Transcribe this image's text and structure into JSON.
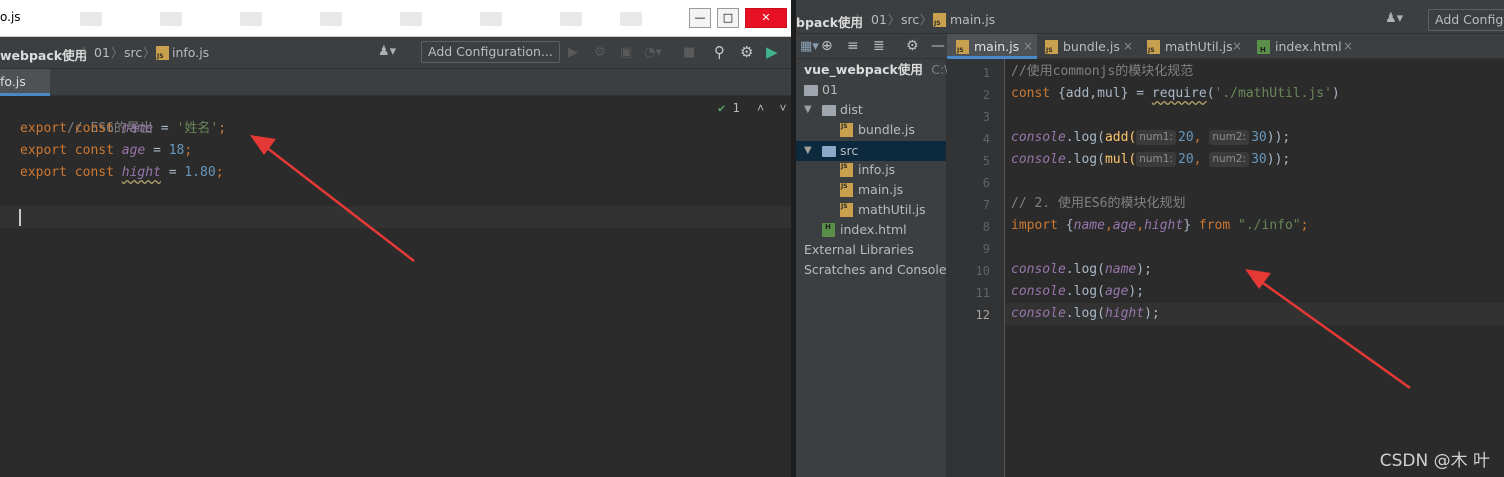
{
  "left": {
    "window_title": "o.js",
    "breadcrumb": [
      "webpack使用",
      "01",
      "src",
      "info.js"
    ],
    "add_configuration": "Add Configuration...",
    "tab": "fo.js",
    "inspection_count": "1",
    "code": {
      "line1_comment": "// ES6的导出",
      "export_kw": "export",
      "const_kw": "const",
      "eq": " = ",
      "semi": ";",
      "var_name": "name",
      "val_name": "'姓名'",
      "var_age": "age",
      "val_age": "18",
      "var_hight": "hight",
      "val_hight": "1.80"
    }
  },
  "right": {
    "breadcrumb": [
      "bpack使用",
      "01",
      "src",
      "main.js"
    ],
    "add_configuration": "Add Config",
    "tabs": [
      {
        "label": "main.js",
        "type": "js",
        "active": true
      },
      {
        "label": "bundle.js",
        "type": "js",
        "active": false
      },
      {
        "label": "mathUtil.js",
        "type": "js",
        "active": false
      },
      {
        "label": "index.html",
        "type": "html",
        "active": false
      }
    ],
    "project_tree": {
      "root": "vue_webpack使用",
      "root_path": "C:\\Us",
      "folder_01": "01",
      "folder_dist": "dist",
      "file_bundle": "bundle.js",
      "folder_src": "src",
      "file_info": "info.js",
      "file_main": "main.js",
      "file_mathutil": "mathUtil.js",
      "file_index": "index.html",
      "external_libraries": "External Libraries",
      "scratches": "Scratches and Consoles"
    },
    "line_numbers": [
      "1",
      "2",
      "3",
      "4",
      "5",
      "6",
      "7",
      "8",
      "9",
      "10",
      "11",
      "12"
    ],
    "code": {
      "l1": "//使用commonjs的模块化规范",
      "const_kw": "const",
      "l2_braces": " {add,mul} = ",
      "require_fn": "require",
      "l2_path": "'./mathUtil.js'",
      "console": "console",
      "log": ".log(",
      "add_fn": "add(",
      "mul_fn": "mul(",
      "hint_num1": "num1:",
      "hint_num2": "num2:",
      "num_20": "20",
      "num_30": "30",
      "comma": ", ",
      "close_parens": "));",
      "l7": "// 2. 使用ES6的模块化规划",
      "import_kw": "import",
      "from_kw": "from",
      "l8_path": "\"./info\"",
      "var_name": "name",
      "var_age": "age",
      "var_hight": "hight",
      "close_log": ");"
    }
  },
  "watermark": "CSDN @木 叶",
  "colors": {
    "keyword": "#cc7832",
    "variable": "#9876aa",
    "string": "#6a8759",
    "number": "#6897bb",
    "comment": "#808080",
    "arrow": "#e53935",
    "selection": "#0d293e"
  }
}
